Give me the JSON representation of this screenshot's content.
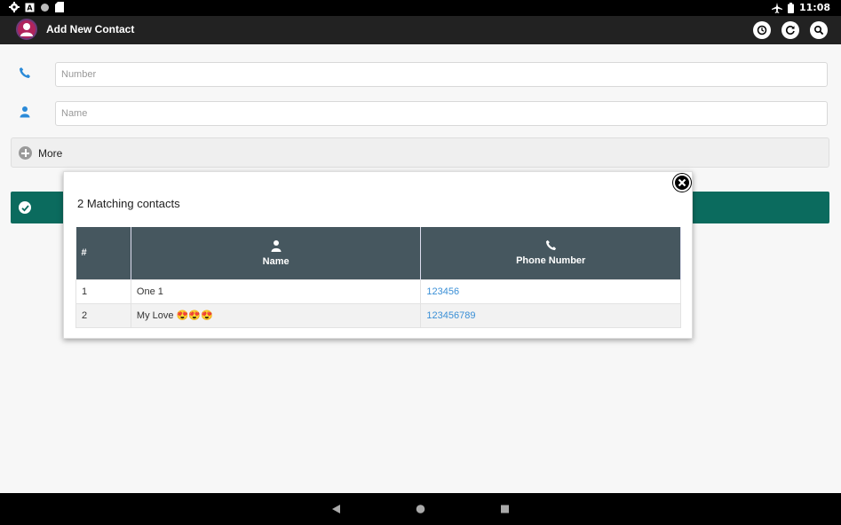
{
  "status_bar": {
    "time": "11:08",
    "icons": [
      "gear-icon",
      "a-icon",
      "circle-icon",
      "sd-card-icon",
      "airplane-icon",
      "battery-icon"
    ]
  },
  "app_bar": {
    "title": "Add New Contact",
    "actions": [
      "history-icon",
      "refresh-icon",
      "search-icon"
    ]
  },
  "form": {
    "number_placeholder": "Number",
    "name_placeholder": "Name",
    "more_label": "More"
  },
  "colors": {
    "save_bar": "#0b6b5e",
    "table_header": "#46575f",
    "link": "#3a8fd6",
    "field_icon": "#2a8ad8"
  },
  "modal": {
    "title": "2 Matching contacts",
    "columns": {
      "index": "#",
      "name": "Name",
      "phone": "Phone Number"
    },
    "rows": [
      {
        "index": "1",
        "name": "One 1",
        "phone": "123456"
      },
      {
        "index": "2",
        "name": "My Love 😍😍😍",
        "phone": "123456789"
      }
    ]
  },
  "nav_bar": {
    "buttons": [
      "back-icon",
      "home-icon",
      "recents-icon"
    ]
  }
}
